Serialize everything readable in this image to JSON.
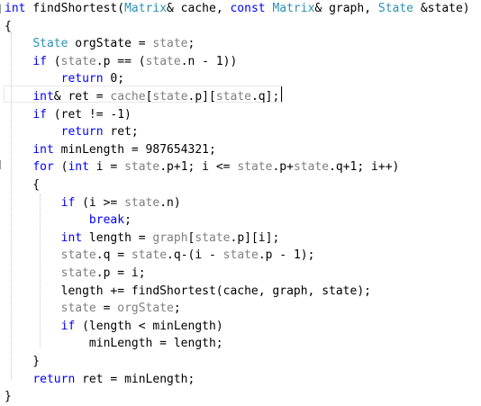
{
  "code_lines": [
    [
      [
        "kw",
        "int"
      ],
      [
        "pl",
        " findShortest("
      ],
      [
        "ty",
        "Matrix"
      ],
      [
        "pl",
        "& cache, "
      ],
      [
        "kw",
        "const"
      ],
      [
        "pl",
        " "
      ],
      [
        "ty",
        "Matrix"
      ],
      [
        "pl",
        "& graph, "
      ],
      [
        "ty",
        "State"
      ],
      [
        "pl",
        " &state)"
      ]
    ],
    [
      [
        "pl",
        "{"
      ]
    ],
    [
      [
        "pl",
        "    "
      ],
      [
        "ty",
        "State"
      ],
      [
        "pl",
        " orgState = "
      ],
      [
        "lc",
        "state"
      ],
      [
        "pl",
        ";"
      ]
    ],
    [
      [
        "pl",
        "    "
      ],
      [
        "kw",
        "if"
      ],
      [
        "pl",
        " ("
      ],
      [
        "lc",
        "state"
      ],
      [
        "pl",
        ".p == ("
      ],
      [
        "lc",
        "state"
      ],
      [
        "pl",
        ".n - 1))"
      ]
    ],
    [
      [
        "pl",
        "        "
      ],
      [
        "kw",
        "return"
      ],
      [
        "pl",
        " 0;"
      ]
    ],
    [
      [
        "pl",
        "    "
      ],
      [
        "kw",
        "int"
      ],
      [
        "pl",
        "& ret = "
      ],
      [
        "lc",
        "cache"
      ],
      [
        "pl",
        "["
      ],
      [
        "lc",
        "state"
      ],
      [
        "pl",
        ".p]["
      ],
      [
        "lc",
        "state"
      ],
      [
        "pl",
        ".q];"
      ]
    ],
    [
      [
        "pl",
        "    "
      ],
      [
        "kw",
        "if"
      ],
      [
        "pl",
        " (ret != -1)"
      ]
    ],
    [
      [
        "pl",
        "        "
      ],
      [
        "kw",
        "return"
      ],
      [
        "pl",
        " ret;"
      ]
    ],
    [
      [
        "pl",
        "    "
      ],
      [
        "kw",
        "int"
      ],
      [
        "pl",
        " minLength = 987654321;"
      ]
    ],
    [
      [
        "pl",
        "    "
      ],
      [
        "kw",
        "for"
      ],
      [
        "pl",
        " ("
      ],
      [
        "kw",
        "int"
      ],
      [
        "pl",
        " i = "
      ],
      [
        "lc",
        "state"
      ],
      [
        "pl",
        ".p+1; i <= "
      ],
      [
        "lc",
        "state"
      ],
      [
        "pl",
        ".p+"
      ],
      [
        "lc",
        "state"
      ],
      [
        "pl",
        ".q+1; i++)"
      ]
    ],
    [
      [
        "pl",
        "    {"
      ]
    ],
    [
      [
        "pl",
        "        "
      ],
      [
        "kw",
        "if"
      ],
      [
        "pl",
        " (i >= "
      ],
      [
        "lc",
        "state"
      ],
      [
        "pl",
        ".n)"
      ]
    ],
    [
      [
        "pl",
        "            "
      ],
      [
        "kw",
        "break"
      ],
      [
        "pl",
        ";"
      ]
    ],
    [
      [
        "pl",
        "        "
      ],
      [
        "kw",
        "int"
      ],
      [
        "pl",
        " length = "
      ],
      [
        "lc",
        "graph"
      ],
      [
        "pl",
        "["
      ],
      [
        "lc",
        "state"
      ],
      [
        "pl",
        ".p][i];"
      ]
    ],
    [
      [
        "pl",
        "        "
      ],
      [
        "lc",
        "state"
      ],
      [
        "pl",
        ".q = "
      ],
      [
        "lc",
        "state"
      ],
      [
        "pl",
        ".q-(i - "
      ],
      [
        "lc",
        "state"
      ],
      [
        "pl",
        ".p - 1);"
      ]
    ],
    [
      [
        "pl",
        "        "
      ],
      [
        "lc",
        "state"
      ],
      [
        "pl",
        ".p = i;"
      ]
    ],
    [
      [
        "pl",
        "        length += findShortest(cache, graph, state);"
      ]
    ],
    [
      [
        "pl",
        "        "
      ],
      [
        "lc",
        "state"
      ],
      [
        "pl",
        " = "
      ],
      [
        "lc",
        "orgState"
      ],
      [
        "pl",
        ";"
      ]
    ],
    [
      [
        "pl",
        "        "
      ],
      [
        "kw",
        "if"
      ],
      [
        "pl",
        " (length < minLength)"
      ]
    ],
    [
      [
        "pl",
        "            minLength = length;"
      ]
    ],
    [
      [
        "pl",
        "    }"
      ]
    ],
    [
      [
        "pl",
        "    "
      ],
      [
        "kw",
        "return"
      ],
      [
        "pl",
        " ret = minLength;"
      ]
    ],
    [
      [
        "pl",
        "}"
      ]
    ]
  ],
  "colors": {
    "keyword": "#0000ff",
    "type": "#2b91af",
    "local": "#7f7f7f",
    "plain": "#000000",
    "background": "#ffffff"
  }
}
